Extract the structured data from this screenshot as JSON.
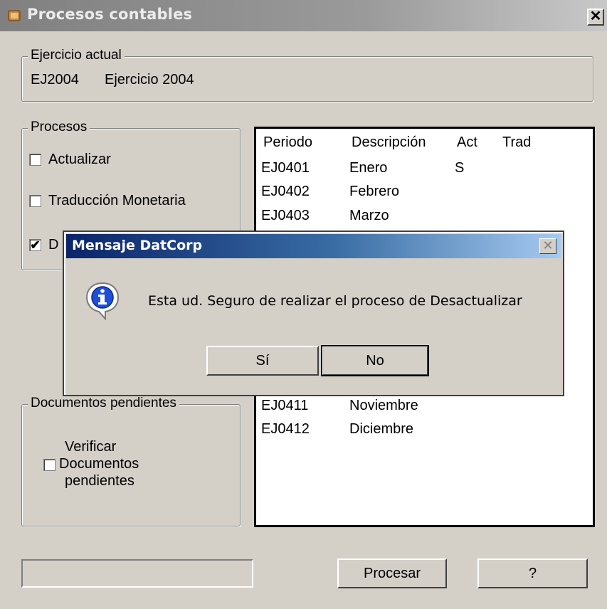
{
  "window": {
    "title": "Procesos contables",
    "close_glyph": "✕"
  },
  "ejercicio": {
    "legend": "Ejercicio actual",
    "code": "EJ2004",
    "description": "Ejercicio 2004"
  },
  "procesos": {
    "legend": "Procesos",
    "items": [
      {
        "label": "Actualizar",
        "checked": false
      },
      {
        "label": "Traducción Monetaria",
        "checked": false
      },
      {
        "label": "D",
        "checked": true
      }
    ]
  },
  "documentos": {
    "legend": "Documentos pendientes",
    "checkbox_label_lines": [
      "Verificar",
      "Documentos",
      "pendientes"
    ],
    "checked": false
  },
  "periodos": {
    "headers": [
      "Periodo",
      "Descripción",
      "Act",
      "Trad"
    ],
    "rows": [
      {
        "periodo": "EJ0401",
        "descripcion": "Enero",
        "act": "S",
        "trad": ""
      },
      {
        "periodo": "EJ0402",
        "descripcion": "Febrero",
        "act": "",
        "trad": ""
      },
      {
        "periodo": "EJ0403",
        "descripcion": "Marzo",
        "act": "",
        "trad": ""
      },
      {
        "periodo": "EJ0411",
        "descripcion": "Noviembre",
        "act": "",
        "trad": ""
      },
      {
        "periodo": "EJ0412",
        "descripcion": "Diciembre",
        "act": "",
        "trad": ""
      }
    ]
  },
  "buttons": {
    "procesar": "Procesar",
    "help": "?"
  },
  "dialog": {
    "title": "Mensaje DatCorp",
    "message": "Esta ud. Seguro de realizar el proceso de Desactualizar",
    "yes": "Sí",
    "no": "No",
    "icon": "info-icon",
    "close_glyph": "✕"
  },
  "colors": {
    "window_bg": "#d4d0c8",
    "dialog_title_start": "#0a246a",
    "dialog_title_end": "#a6caf0"
  }
}
